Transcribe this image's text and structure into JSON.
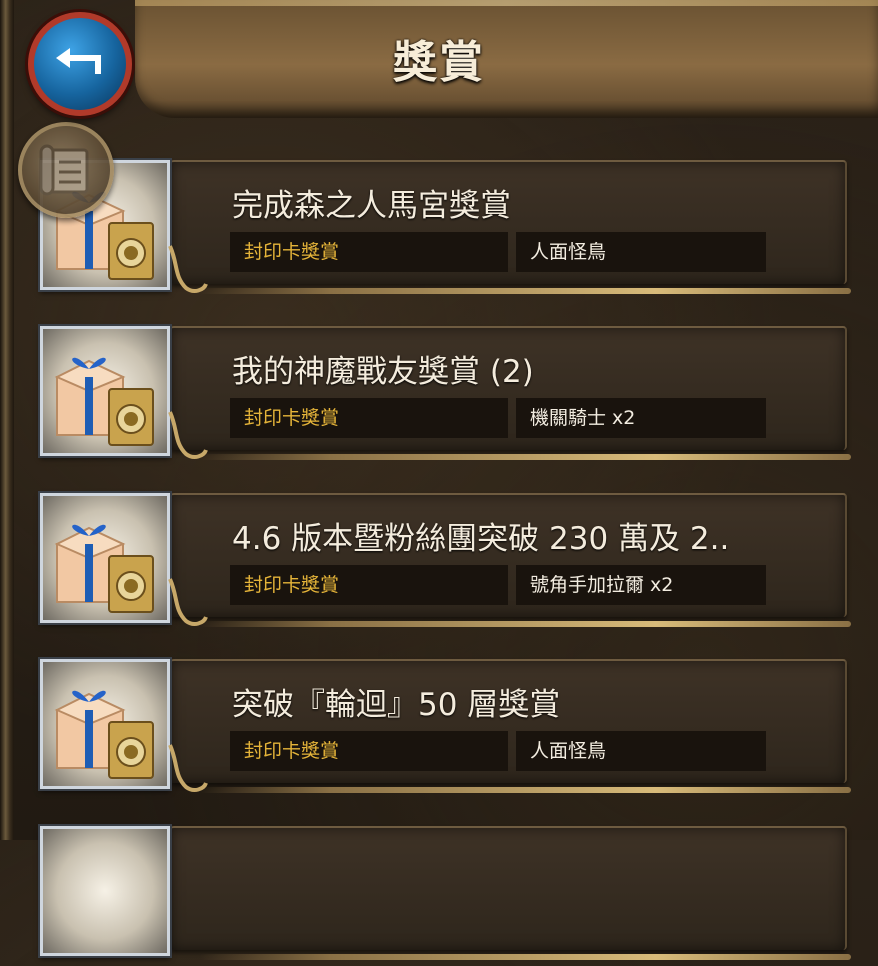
{
  "header": {
    "title": "獎賞"
  },
  "colors": {
    "gold_label": "#e5b439",
    "title_text": "#f4ecdd",
    "back_button_blue": "#16649e"
  },
  "rewards": [
    {
      "title": "完成森之人馬宮獎賞",
      "type": "封印卡獎賞",
      "reward": "人面怪鳥",
      "icon": "gift-box-with-card-icon"
    },
    {
      "title": "我的神魔戰友獎賞 (2)",
      "type": "封印卡獎賞",
      "reward": "機關騎士 x2",
      "icon": "gift-box-with-card-icon"
    },
    {
      "title": " 4.6 版本暨粉絲團突破 230 萬及 2..",
      "type": "封印卡獎賞",
      "reward": "號角手加拉爾 x2",
      "icon": "gift-box-with-card-icon"
    },
    {
      "title": "突破『輪迴』50 層獎賞",
      "type": "封印卡獎賞",
      "reward": "人面怪鳥",
      "icon": "gift-box-with-card-icon"
    }
  ]
}
